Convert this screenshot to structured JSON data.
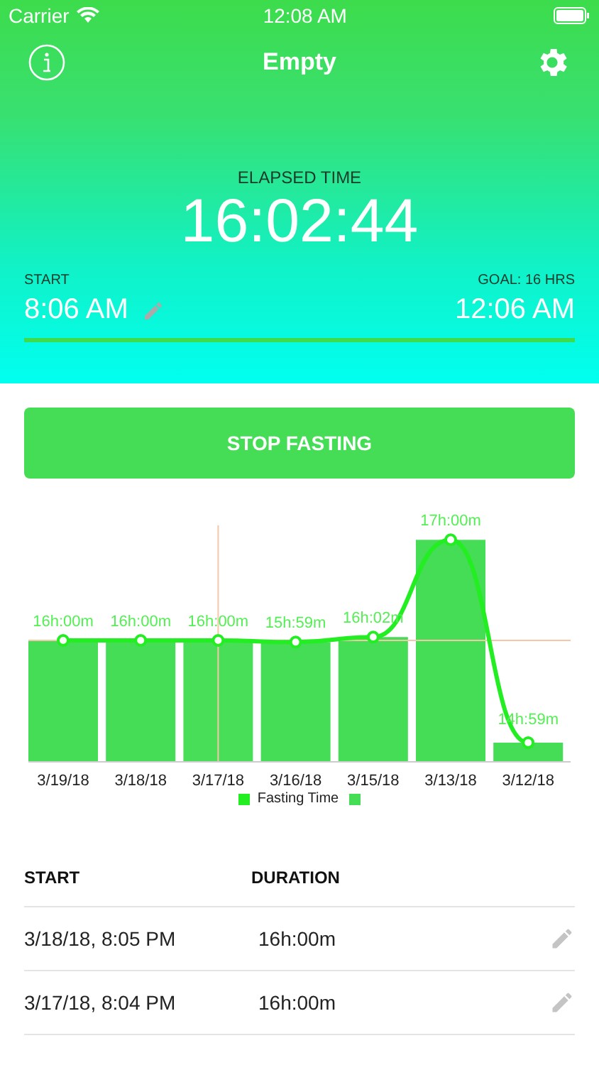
{
  "status_bar": {
    "carrier": "Carrier",
    "time": "12:08 AM"
  },
  "nav": {
    "title": "Empty"
  },
  "timer": {
    "label": "ELAPSED TIME",
    "value": "16:02:44",
    "start_label": "START",
    "start_time": "8:06 AM",
    "goal_label": "GOAL: 16 HRS",
    "end_time": "12:06 AM",
    "level": 1
  },
  "action_button": "STOP FASTING",
  "fasting_chart": {
    "days": [
      {
        "date": "3/19/18",
        "duration": "16h:00m",
        "selected": false
      },
      {
        "date": "3/18/18",
        "duration": "16h:00m",
        "selected": false
      },
      {
        "date": "3/17/18",
        "duration": "16h:00m",
        "selected": true
      },
      {
        "date": "3/16/18",
        "duration": "15h:59m",
        "selected": false
      },
      {
        "date": "3/15/18",
        "duration": "16h:02m",
        "selected": false
      },
      {
        "date": "3/13/18",
        "duration": "17h:00m",
        "selected": false
      },
      {
        "date": "3/12/18",
        "duration": "14h:59m",
        "selected": false
      }
    ],
    "legend": [
      {
        "label": "Fasting Time",
        "color": "#22ee22"
      },
      {
        "color": "#44dd55"
      }
    ]
  },
  "history": {
    "columns": [
      "START",
      "DURATION"
    ],
    "rows": [
      {
        "start": "3/18/18, 8:05 PM",
        "duration": "16h:00m"
      },
      {
        "start": "3/17/18, 8:04 PM",
        "duration": "16h:00m"
      }
    ]
  }
}
